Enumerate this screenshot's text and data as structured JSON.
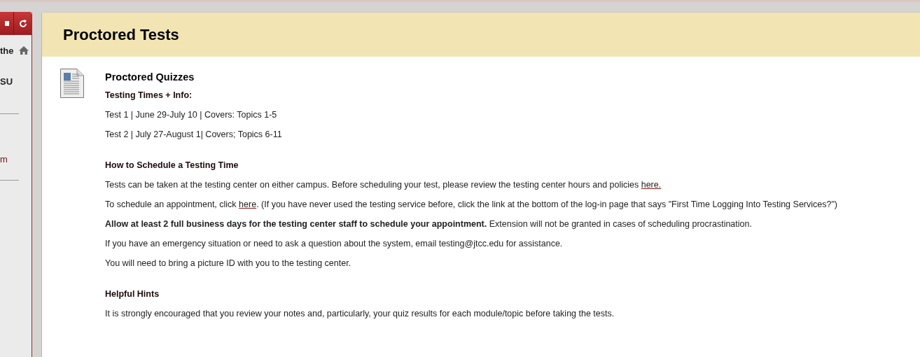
{
  "sidebar": {
    "items": [
      {
        "kind": "item",
        "label": "the",
        "home": true
      },
      {
        "kind": "item",
        "label": "SU"
      },
      {
        "kind": "divider"
      },
      {
        "kind": "link",
        "label": "m"
      },
      {
        "kind": "divider"
      }
    ]
  },
  "page": {
    "title": "Proctored Tests"
  },
  "content_item": {
    "title": "Proctored Quizzes",
    "sections": [
      {
        "heading": "Testing Times + Info:",
        "paragraphs": [
          {
            "text": "Test 1 | June 29-July 10 | Covers: Topics 1-5"
          },
          {
            "text": "Test 2 | July 27-August 1| Covers; Topics 6-11"
          }
        ]
      },
      {
        "heading": "How to Schedule a Testing Time",
        "paragraphs": [
          {
            "text": "Tests can be taken at the testing center on either campus. Before scheduling your test, please review the testing center hours and policies ",
            "link": "here."
          },
          {
            "text": "To schedule an appointment, click ",
            "link": "here",
            "after": ". (If you have never used the testing service before, click the link at the bottom of the log-in page that says \"First Time Logging Into Testing Services?\")"
          },
          {
            "text": "**Allow at least 2 full business days for the testing center staff to schedule your appointment.** Extension will not be granted in cases of scheduling procrastination."
          },
          {
            "text": "If you have an emergency situation or need to ask a question about the system, email testing@jtcc.edu for assistance."
          },
          {
            "text": "You will need to bring a picture ID with you to the testing center."
          }
        ]
      },
      {
        "heading": "Helpful Hints",
        "paragraphs": [
          {
            "text": "It is strongly encouraged that you review your notes and, particularly, your quiz results for each module/topic before taking the tests."
          }
        ]
      }
    ]
  }
}
